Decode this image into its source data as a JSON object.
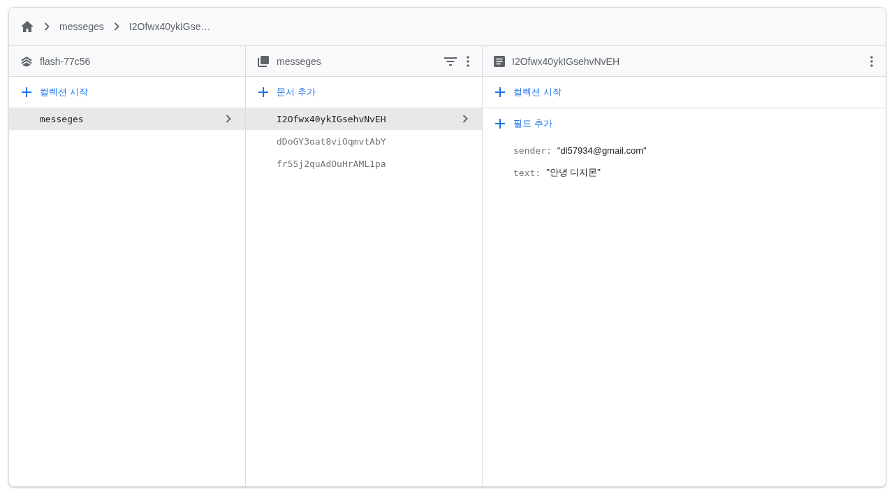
{
  "breadcrumb": [
    "messeges",
    "I2Ofwx40ykIGse…"
  ],
  "columns": [
    {
      "kind": "root",
      "title": "flash-77c56",
      "action": "컬렉션 시작",
      "items": [
        {
          "label": "messeges",
          "selected": true
        }
      ]
    },
    {
      "kind": "collection",
      "title": "messeges",
      "action": "문서 추가",
      "items": [
        {
          "label": "I2Ofwx40ykIGsehvNvEH",
          "selected": true
        },
        {
          "label": "dDoGY3oat8viOqmvtAbY",
          "selected": false
        },
        {
          "label": "fr55j2quAdOuHrAML1pa",
          "selected": false
        }
      ]
    },
    {
      "kind": "document",
      "title": "I2Ofwx40ykIGsehvNvEH",
      "action": "컬렉션 시작",
      "field_action": "필드 추가",
      "fields": [
        {
          "key": "sender:",
          "value": "\"dl57934@gmail.com\""
        },
        {
          "key": "text:",
          "value": "\"안녕 디지몬\""
        }
      ]
    }
  ]
}
